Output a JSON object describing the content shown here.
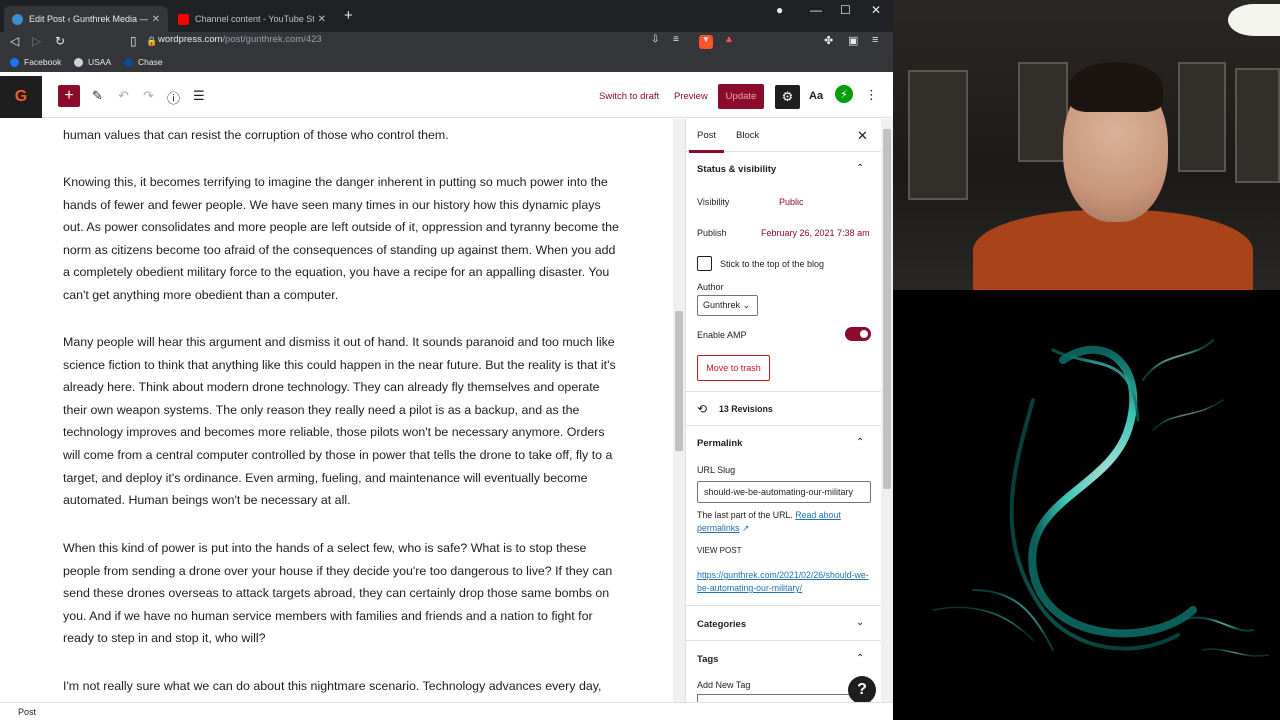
{
  "browser": {
    "tabs": [
      {
        "title": "Edit Post ‹ Gunthrek Media — W",
        "active": true
      },
      {
        "title": "Channel content - YouTube Studio",
        "active": false
      }
    ],
    "url_host": "wordpress.com",
    "url_path": "/post/gunthrek.com/423",
    "bookmarks": [
      "Facebook",
      "USAA",
      "Chase"
    ]
  },
  "toolbar": {
    "logo": "G",
    "switch_to_draft": "Switch to draft",
    "preview": "Preview",
    "update": "Update",
    "aa": "Aa"
  },
  "content": {
    "paragraphs": [
      "human values that can resist the corruption of those who control them.",
      "Knowing this, it becomes terrifying to imagine the danger inherent in putting so much power into the hands of fewer and fewer people.  We have seen many times in our history how this dynamic plays out.  As power consolidates and more people are left outside of it, oppression and tyranny become the norm as citizens become too afraid of the consequences of standing up against them.  When you add a completely obedient military force to the equation, you have a recipe for an appalling disaster.  You can't get anything more obedient than a computer.",
      "Many people will hear this argument and dismiss it out of hand.  It sounds paranoid and too much like science fiction to think that anything like this could happen in the near future.  But the reality is that it's already here.  Think about modern drone technology.  They can already fly themselves and operate their own weapon systems.  The only reason they really need a pilot is as a backup, and as the technology improves and becomes more reliable, those pilots won't be necessary anymore.  Orders will come from a central computer controlled by those in power that tells the drone to take off, fly to a target, and deploy it's ordinance.  Even arming, fueling, and maintenance will eventually become automated.  Human beings won't be necessary at all.",
      "When this kind of power is put into the hands of a select few, who is safe?  What is to stop these people from sending a drone over your house if they decide you're too dangerous to live?  If they can send these drones overseas to attack targets abroad, they can certainly drop those same bombs on you.  And if we have no human service members with families and friends and a nation to fight for ready to step in and stop it, who will?",
      "I'm not really sure what we can do about this nightmare scenario.  Technology advances every day,"
    ]
  },
  "sidebar": {
    "tab_post": "Post",
    "tab_block": "Block",
    "status_heading": "Status & visibility",
    "visibility_label": "Visibility",
    "visibility_value": "Public",
    "publish_label": "Publish",
    "publish_value": "February 26, 2021 7:38 am",
    "sticky_label": "Stick to the top of the blog",
    "author_label": "Author",
    "author_value": "Gunthrek",
    "amp_label": "Enable AMP",
    "trash_label": "Move to trash",
    "revisions": "13 Revisions",
    "permalink_heading": "Permalink",
    "slug_label": "URL Slug",
    "slug_value": "should-we-be-automating-our-military",
    "help_text": "The last part of the URL.",
    "help_link": "Read about permalinks",
    "view_post_label": "VIEW POST",
    "view_post_url": "https://gunthrek.com/2021/02/26/should-we-be-automating-our-military/",
    "categories_heading": "Categories",
    "tags_heading": "Tags",
    "add_tag_label": "Add New Tag"
  },
  "statusbar": {
    "label": "Post"
  },
  "colors": {
    "accent": "#8b0b2d",
    "link": "#2271b1",
    "danger": "#cc1818"
  }
}
